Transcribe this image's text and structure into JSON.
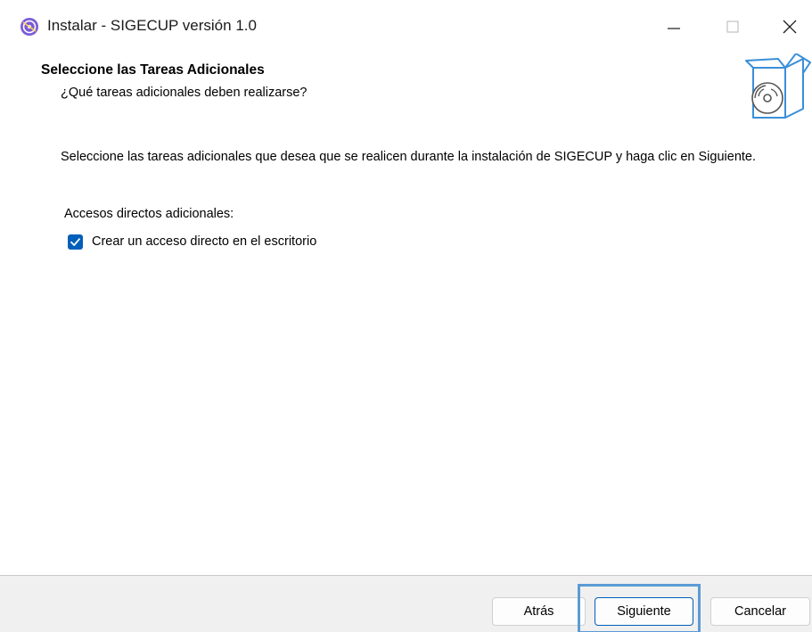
{
  "window": {
    "title": "Instalar - SIGECUP versión 1.0",
    "icon": "installer-app-icon",
    "controls": [
      "minimize-icon",
      "maximize-icon",
      "close-icon"
    ]
  },
  "header": {
    "title": "Seleccione las Tareas Adicionales",
    "subtitle": "¿Qué tareas adicionales deben realizarse?",
    "icon": "box-with-disc-icon"
  },
  "body": {
    "instruction": "Seleccione las tareas adicionales que desea que se realicen durante la instalación de SIGECUP y haga clic en Siguiente.",
    "group_label": "Accesos directos adicionales:",
    "tasks": [
      {
        "label": "Crear un acceso directo en el escritorio",
        "checked": true
      }
    ]
  },
  "footer": {
    "back_label": "Atrás",
    "next_label": "Siguiente",
    "cancel_label": "Cancelar"
  },
  "colors": {
    "accent": "#005fb8",
    "focus": "#5b9bd5",
    "footer_bg": "#f0f0f0"
  }
}
